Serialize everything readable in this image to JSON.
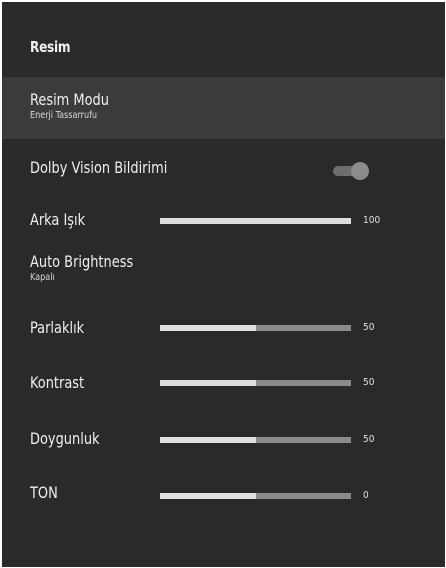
{
  "panel": {
    "title": "Resim"
  },
  "colors": {
    "background": "#2a2a2a",
    "selected_row": "#3b3b3b",
    "slider_fill": "#dedede",
    "slider_track": "#8a8a8a",
    "text": "#efefef"
  },
  "items": {
    "picture_mode": {
      "label": "Resim Modu",
      "value": "Enerji Tassarrufu",
      "selected": true
    },
    "dolby_vision": {
      "label": "Dolby Vision Bildirimi",
      "toggle_on": true,
      "icon": "toggle-switch-icon"
    },
    "backlight": {
      "label": "Arka Işık",
      "value": "100",
      "level": 1.0
    },
    "auto_brightness": {
      "label": "Auto Brightness",
      "value": "Kapalı"
    },
    "brightness": {
      "label": "Parlaklık",
      "value": "50",
      "level": 0.5
    },
    "contrast": {
      "label": "Kontrast",
      "value": "50",
      "level": 0.5
    },
    "saturation": {
      "label": "Doygunluk",
      "value": "50",
      "level": 0.5
    },
    "tone": {
      "label": "TON",
      "value": "0",
      "level": 0.5
    }
  }
}
